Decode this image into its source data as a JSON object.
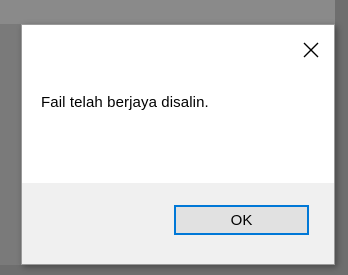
{
  "dialog": {
    "message": "Fail telah berjaya disalin.",
    "ok_label": "OK",
    "close_icon": "close-icon",
    "accent_color": "#0078d7"
  }
}
